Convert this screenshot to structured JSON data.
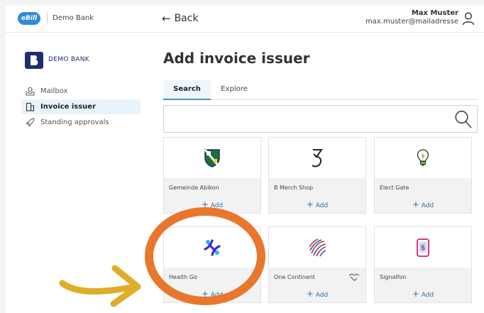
{
  "topbar": {
    "logo_text": "eBill",
    "bank_name": "Demo Bank",
    "back_label": "Back",
    "back_arrow": "←",
    "user_name": "Max Muster",
    "user_email": "max.muster@mailadresse"
  },
  "sidebar": {
    "bank_logo_text": "DEMO BANK",
    "items": [
      {
        "label": "Mailbox",
        "icon": "mailbox-icon",
        "active": false
      },
      {
        "label": "Invoice issuer",
        "icon": "building-icon",
        "active": true
      },
      {
        "label": "Standing approvals",
        "icon": "rocket-icon",
        "active": false
      }
    ]
  },
  "main": {
    "title": "Add invoice issuer",
    "tabs": [
      {
        "label": "Search",
        "active": true
      },
      {
        "label": "Explore",
        "active": false
      }
    ],
    "search": {
      "value": "",
      "placeholder": ""
    },
    "add_label": "Add",
    "add_plus": "+",
    "cards": [
      {
        "name": "Gemeinde Abikon",
        "logo": "shield-crest-icon"
      },
      {
        "name": "B Merch Shop",
        "logo": "b-merch-logo-icon"
      },
      {
        "name": "Elect Gate",
        "logo": "lightbulb-icon"
      },
      {
        "name": "Health Go",
        "logo": "health-go-logo-icon"
      },
      {
        "name": "One Continent",
        "logo": "globe-lines-icon",
        "badge": "handshake-icon"
      },
      {
        "name": "Signalfon",
        "logo": "phone-dollar-icon"
      }
    ]
  },
  "colors": {
    "accent": "#2f8bd9",
    "link": "#2f6fa6",
    "active_bg": "#e8f4fb",
    "highlight_circle": "#e8772e",
    "highlight_arrow": "#e0ad2a"
  }
}
